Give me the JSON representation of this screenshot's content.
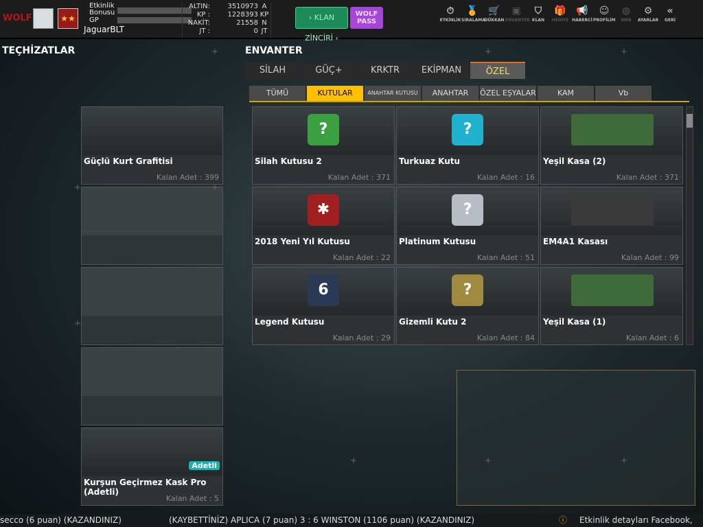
{
  "header": {
    "logo": "WOLF DİRİLİŞ",
    "event_bonus_label": "Etkinlik Bonusu",
    "gp_label": "GP",
    "username": "JaguarBLT",
    "currencies": [
      {
        "key": "ALTIN:",
        "value": "3510973",
        "unit": "A"
      },
      {
        "key": "KP :",
        "value": "1228393",
        "unit": "KP"
      },
      {
        "key": "NAKİT:",
        "value": "21558",
        "unit": "N"
      },
      {
        "key": "JT :",
        "value": "0",
        "unit": "JT"
      }
    ],
    "klan_button": "› KLAN ZİNCİRİ ‹",
    "wolf_pass_button": "WOLF PASS",
    "nav": [
      {
        "label": "ETKİNLİK",
        "icon": "⏱"
      },
      {
        "label": "SIRALAMA",
        "icon": "🏅"
      },
      {
        "label": "DÜKKAN",
        "icon": "🛒"
      },
      {
        "label": "ENVANTER",
        "icon": "▣"
      },
      {
        "label": "KLAN",
        "icon": "⛉"
      },
      {
        "label": "HEDİYE",
        "icon": "🎁"
      },
      {
        "label": "HABERCİ",
        "icon": "📢"
      },
      {
        "label": "PROFİLİM",
        "icon": "☺"
      },
      {
        "label": "WEB",
        "icon": "◍"
      },
      {
        "label": "AYARLAR",
        "icon": "⚙"
      },
      {
        "label": "GERİ",
        "icon": "«"
      }
    ]
  },
  "equipment": {
    "title": "TEÇHİZATLAR",
    "slots": [
      {
        "name": "Güçlü Kurt Grafitisi",
        "count": "Kalan Adet : 399"
      },
      {},
      {},
      {},
      {
        "name": "Kurşun Geçirmez Kask Pro (Adetli)",
        "count": "Kalan Adet : 5",
        "badge": "Adetli"
      }
    ]
  },
  "inventory": {
    "title": "ENVANTER",
    "tabs": [
      "SİLAH",
      "GÜÇ+",
      "KRKTR",
      "EKİPMAN",
      "ÖZEL"
    ],
    "active_tab": "ÖZEL",
    "subtabs": [
      "TÜMÜ",
      "KUTULAR",
      "ANAHTAR KUTUSU",
      "ANAHTAR",
      "ÖZEL EŞYALAR",
      "KAM",
      "Vb"
    ],
    "active_subtab": "KUTULAR",
    "items": [
      {
        "name": "Silah Kutusu 2",
        "count": "Kalan Adet : 371",
        "color": "#3aa040",
        "glyph": "?"
      },
      {
        "name": "Turkuaz Kutu",
        "count": "Kalan Adet : 16",
        "color": "#20b0d0",
        "glyph": "?"
      },
      {
        "name": "Yeşil Kasa (2)",
        "count": "Kalan Adet : 371",
        "color": "#3f6a3a",
        "glyph": ""
      },
      {
        "name": "2018 Yeni Yıl Kutusu",
        "count": "Kalan Adet : 22",
        "color": "#a02020",
        "glyph": "✱"
      },
      {
        "name": "Platinum Kutusu",
        "count": "Kalan Adet : 51",
        "color": "#b8bcc4",
        "glyph": "?"
      },
      {
        "name": "EM4A1 Kasası",
        "count": "Kalan Adet : 99",
        "color": "#3a3a3a",
        "glyph": ""
      },
      {
        "name": "Legend Kutusu",
        "count": "Kalan Adet : 29",
        "color": "#2a3a55",
        "glyph": "6"
      },
      {
        "name": "Gizemli Kutu 2",
        "count": "Kalan Adet : 84",
        "color": "#a08a40",
        "glyph": "?"
      },
      {
        "name": "Yeşil Kasa (1)",
        "count": "Kalan Adet : 6",
        "color": "#3f6a3a",
        "glyph": ""
      }
    ]
  },
  "ticker": {
    "left": "secco (6 puan) (KAZANDINIZ)",
    "middle": "(KAYBETTİNİZ) APLICA (7 puan) 3 : 6 WINSTON (1106 puan) (KAZANDINIZ)",
    "right": "Etkinlik detayları Facebook,"
  }
}
